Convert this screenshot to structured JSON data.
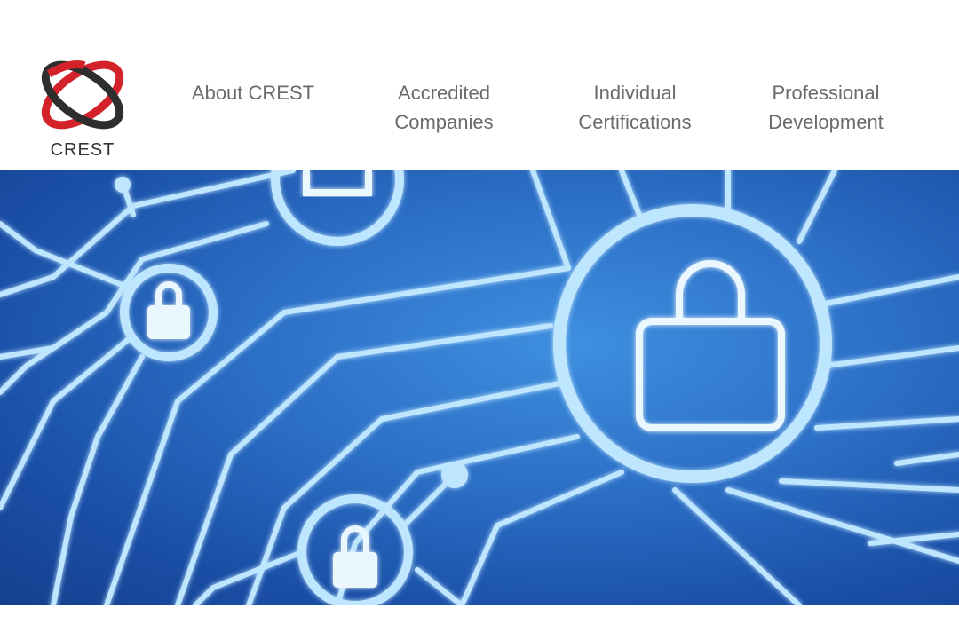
{
  "brand": {
    "logo_text": "CREST",
    "colors": {
      "ring_red": "#d3222a",
      "ring_dark": "#2e2e2e",
      "hero_blue": "#2c6fc6",
      "circuit": "#bfe6ff",
      "nav_text": "#6b6b6b"
    }
  },
  "nav": {
    "about": {
      "line1": "About CREST"
    },
    "accredited": {
      "line1": "Accredited",
      "line2": "Companies"
    },
    "individual": {
      "line1": "Individual",
      "line2": "Certifications"
    },
    "professional": {
      "line1": "Professional",
      "line2": "Development"
    }
  },
  "hero": {
    "icon": "padlock-circuit-icon"
  }
}
